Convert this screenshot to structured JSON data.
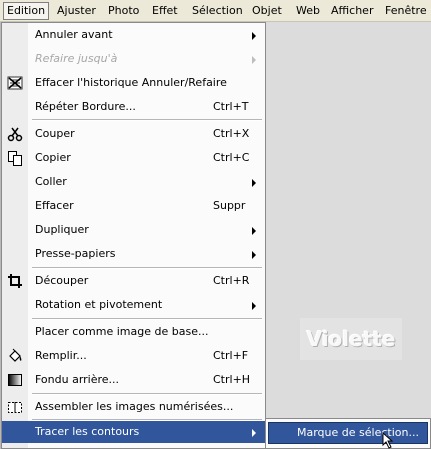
{
  "menubar": {
    "items": [
      {
        "label": "Edition",
        "active": true
      },
      {
        "label": "Ajuster"
      },
      {
        "label": "Photo"
      },
      {
        "label": "Effet"
      },
      {
        "label": "Sélection"
      },
      {
        "label": "Objet"
      },
      {
        "label": "Web"
      },
      {
        "label": "Afficher"
      },
      {
        "label": "Fenêtre"
      }
    ]
  },
  "menu": {
    "annuler_avant": "Annuler avant",
    "refaire": "Refaire jusqu'à",
    "effacer_historique": "Effacer l'historique Annuler/Refaire",
    "repeter": "Répéter Bordure...",
    "repeter_sc": "Ctrl+T",
    "couper": "Couper",
    "couper_sc": "Ctrl+X",
    "copier": "Copier",
    "copier_sc": "Ctrl+C",
    "coller": "Coller",
    "effacer": "Effacer",
    "effacer_sc": "Suppr",
    "dupliquer": "Dupliquer",
    "presse_papiers": "Presse-papiers",
    "decouper": "Découper",
    "decouper_sc": "Ctrl+R",
    "rotation": "Rotation et pivotement",
    "placer": "Placer comme image de base...",
    "remplir": "Remplir...",
    "remplir_sc": "Ctrl+F",
    "fondu": "Fondu arrière...",
    "fondu_sc": "Ctrl+H",
    "assembler": "Assembler les images numérisées...",
    "tracer": "Tracer les contours"
  },
  "submenu": {
    "marque": "Marque de sélection..."
  },
  "canvas": {
    "watermark": "Violette"
  },
  "colors": {
    "highlight": "#31569c",
    "menubar_bg": "#ece9d8",
    "menu_bg": "#fbfbfb"
  }
}
